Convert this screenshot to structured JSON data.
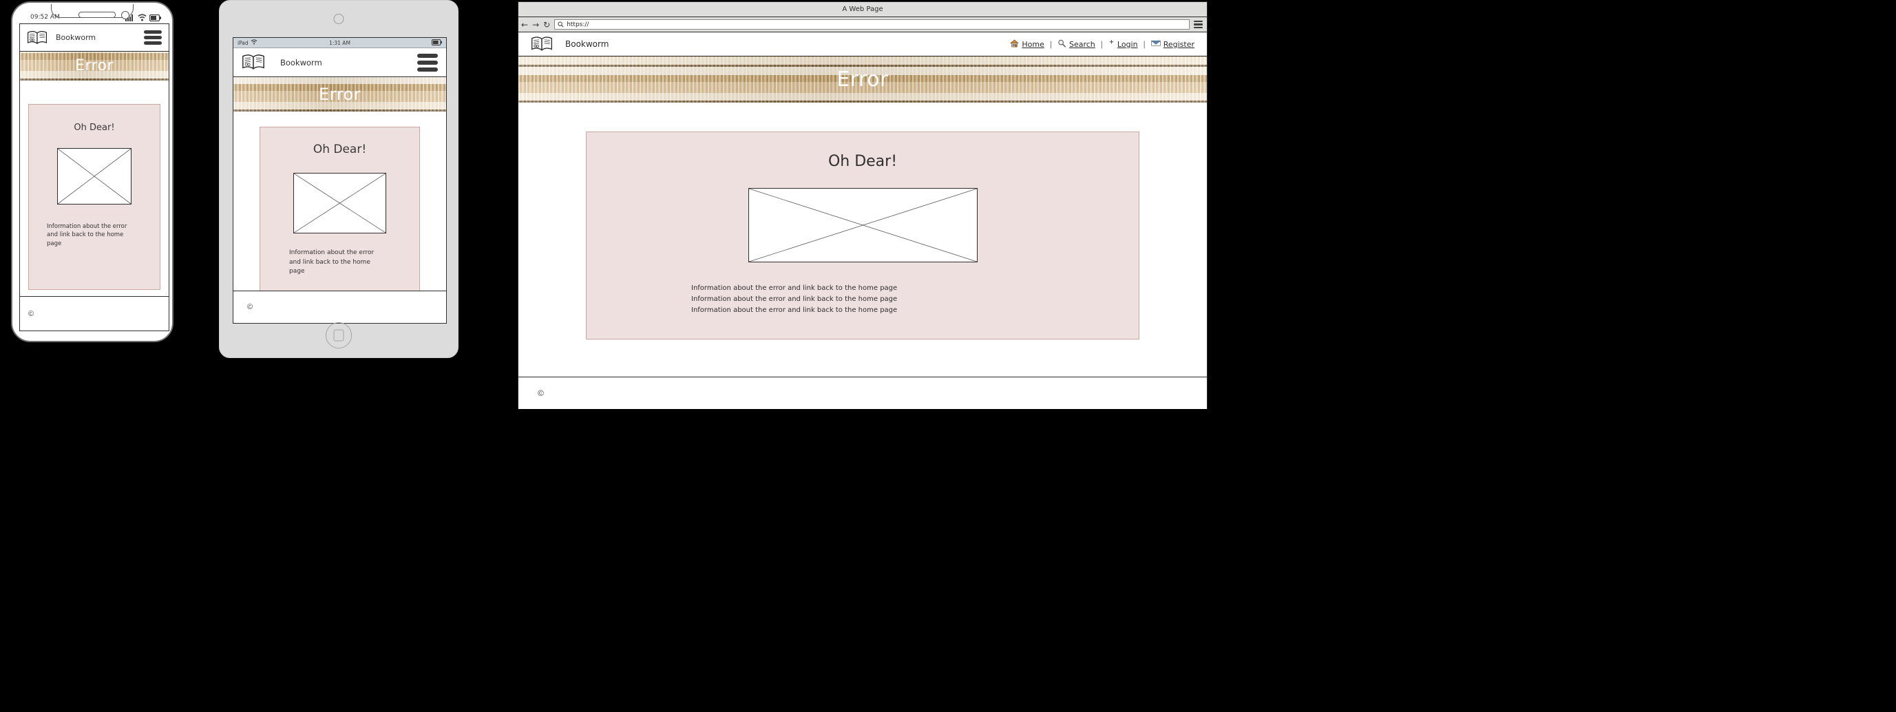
{
  "brand": {
    "name": "Bookworm",
    "logo_icon": "open-book-icon"
  },
  "hero": {
    "title": "Error"
  },
  "error_panel": {
    "heading": "Oh Dear!",
    "image_placeholder": "image-placeholder",
    "paragraph": "Information about the error and link back to the home page",
    "paragraph_lines": [
      "Information about the error and link back to the home page",
      "Information about the error and link back to the home page",
      "Information about the error and link back to the home page"
    ]
  },
  "footer": {
    "copyright": "©"
  },
  "phone": {
    "status_time": "09:52 AM",
    "menu_icon": "hamburger-menu-icon",
    "signal_icon": "signal-bars-icon",
    "wifi_icon": "wifi-icon",
    "battery_icon": "battery-icon"
  },
  "tablet": {
    "device_label": "iPad",
    "status_time": "1:31 AM",
    "menu_icon": "hamburger-menu-icon",
    "wifi_icon": "wifi-icon",
    "battery_icon": "battery-icon",
    "camera_icon": "camera-icon",
    "home_button_icon": "home-button-icon"
  },
  "browser": {
    "window_title": "A Web Page",
    "back_icon": "←",
    "forward_icon": "→",
    "reload_icon": "↻",
    "search_icon": "search-icon",
    "url_value": "https://",
    "url_placeholder": "https://",
    "menu_icon": "hamburger-menu-icon",
    "nav_links": [
      {
        "label": "Home",
        "icon": "house-icon"
      },
      {
        "label": "Search",
        "icon": "magnifier-icon"
      },
      {
        "label": "Login",
        "icon": "plus-icon"
      },
      {
        "label": "Register",
        "icon": "envelope-icon"
      }
    ],
    "nav_separator": "|"
  },
  "colors": {
    "panel_bg": "#eee0de",
    "panel_border": "#c9a8a4",
    "device_frame": "#dcdcdc",
    "chrome_bg": "#dededc",
    "hero_text": "#ffffff"
  }
}
